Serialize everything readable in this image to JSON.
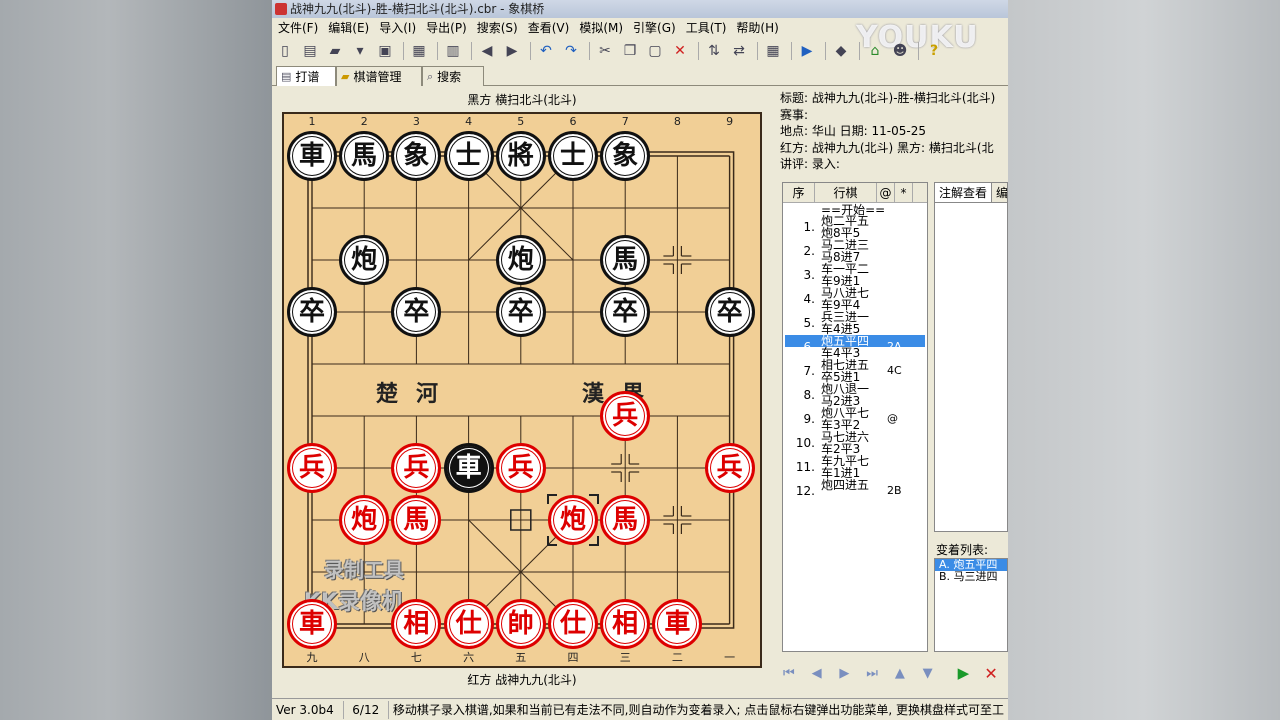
{
  "window": {
    "title": "战神九九(北斗)-胜-横扫北斗(北斗).cbr - 象棋桥"
  },
  "watermark": "YOUKU",
  "menus": [
    "文件(F)",
    "编辑(E)",
    "导入(I)",
    "导出(P)",
    "搜索(S)",
    "查看(V)",
    "模拟(M)",
    "引擎(G)",
    "工具(T)",
    "帮助(H)"
  ],
  "toolbar": [
    {
      "icon": "new-file-icon",
      "glyph": "▯"
    },
    {
      "icon": "list-icon",
      "glyph": "▤"
    },
    {
      "icon": "open-folder-icon",
      "glyph": "▰"
    },
    {
      "icon": "dropdown-icon",
      "glyph": "▾"
    },
    {
      "icon": "save-icon",
      "glyph": "▣"
    },
    {
      "sep": true
    },
    {
      "icon": "print-icon",
      "glyph": "▦"
    },
    {
      "sep": true
    },
    {
      "icon": "delete-icon",
      "glyph": "▥"
    },
    {
      "sep": true
    },
    {
      "icon": "back-icon",
      "glyph": "◀"
    },
    {
      "icon": "forward-icon",
      "glyph": "▶"
    },
    {
      "sep": true
    },
    {
      "icon": "undo-icon",
      "glyph": "↶"
    },
    {
      "icon": "redo-icon",
      "glyph": "↷"
    },
    {
      "sep": true
    },
    {
      "icon": "cut-icon",
      "glyph": "✂"
    },
    {
      "icon": "copy-icon",
      "glyph": "❐"
    },
    {
      "icon": "paste-icon",
      "glyph": "▢"
    },
    {
      "icon": "close-icon",
      "glyph": "✕"
    },
    {
      "sep": true
    },
    {
      "icon": "flip-vertical-icon",
      "glyph": "⇅"
    },
    {
      "icon": "flip-horizontal-icon",
      "glyph": "⇄"
    },
    {
      "sep": true
    },
    {
      "icon": "board-window-icon",
      "glyph": "▦"
    },
    {
      "sep": true
    },
    {
      "icon": "play-circle-icon",
      "glyph": "▶"
    },
    {
      "sep": true
    },
    {
      "icon": "tag-icon",
      "glyph": "◆"
    },
    {
      "sep": true
    },
    {
      "icon": "home-icon",
      "glyph": "⌂"
    },
    {
      "icon": "users-icon",
      "glyph": "☻"
    },
    {
      "sep": true
    },
    {
      "icon": "help-icon",
      "glyph": "?"
    }
  ],
  "tabs": [
    {
      "label": "打谱",
      "icon": "document-icon",
      "glyph": "▤",
      "active": true
    },
    {
      "label": "棋谱管理",
      "icon": "folder-icon",
      "glyph": "▰",
      "active": false
    },
    {
      "label": "搜索",
      "icon": "search-icon",
      "glyph": "⌕",
      "active": false
    }
  ],
  "board": {
    "top_player": "黑方  横扫北斗(北斗)",
    "bottom_player": "红方  战神九九(北斗)",
    "top_files": [
      "1",
      "2",
      "3",
      "4",
      "5",
      "6",
      "7",
      "8",
      "9"
    ],
    "bottom_files": [
      "九",
      "八",
      "七",
      "六",
      "五",
      "四",
      "三",
      "二",
      "一"
    ],
    "river_left": "楚河",
    "river_right": "漢界",
    "overlay_line1": "录制工具",
    "overlay_line2": "KK录像机",
    "pieces": [
      {
        "name": "black-chariot",
        "char": "車",
        "side": "black",
        "file": 0,
        "rank": 0
      },
      {
        "name": "black-horse",
        "char": "馬",
        "side": "black",
        "file": 1,
        "rank": 0
      },
      {
        "name": "black-elephant",
        "char": "象",
        "side": "black",
        "file": 2,
        "rank": 0
      },
      {
        "name": "black-advisor",
        "char": "士",
        "side": "black",
        "file": 3,
        "rank": 0
      },
      {
        "name": "black-general",
        "char": "將",
        "side": "black",
        "file": 4,
        "rank": 0
      },
      {
        "name": "black-advisor-2",
        "char": "士",
        "side": "black",
        "file": 5,
        "rank": 0
      },
      {
        "name": "black-elephant-2",
        "char": "象",
        "side": "black",
        "file": 6,
        "rank": 0
      },
      {
        "name": "black-cannon",
        "char": "炮",
        "side": "black",
        "file": 1,
        "rank": 2
      },
      {
        "name": "black-cannon-2",
        "char": "炮",
        "side": "black",
        "file": 4,
        "rank": 2
      },
      {
        "name": "black-horse-2",
        "char": "馬",
        "side": "black",
        "file": 6,
        "rank": 2
      },
      {
        "name": "black-soldier",
        "char": "卒",
        "side": "black",
        "file": 0,
        "rank": 3
      },
      {
        "name": "black-soldier-2",
        "char": "卒",
        "side": "black",
        "file": 2,
        "rank": 3
      },
      {
        "name": "black-soldier-3",
        "char": "卒",
        "side": "black",
        "file": 4,
        "rank": 3
      },
      {
        "name": "black-soldier-4",
        "char": "卒",
        "side": "black",
        "file": 6,
        "rank": 3
      },
      {
        "name": "black-soldier-5",
        "char": "卒",
        "side": "black",
        "file": 8,
        "rank": 3
      },
      {
        "name": "red-soldier",
        "char": "兵",
        "side": "red",
        "file": 6,
        "rank": 5
      },
      {
        "name": "red-soldier-2",
        "char": "兵",
        "side": "red",
        "file": 0,
        "rank": 6
      },
      {
        "name": "red-soldier-3",
        "char": "兵",
        "side": "red",
        "file": 2,
        "rank": 6
      },
      {
        "name": "black-chariot-2",
        "char": "車",
        "side": "rev-black",
        "file": 3,
        "rank": 6
      },
      {
        "name": "red-soldier-4",
        "char": "兵",
        "side": "red",
        "file": 4,
        "rank": 6
      },
      {
        "name": "red-soldier-5",
        "char": "兵",
        "side": "red",
        "file": 8,
        "rank": 6
      },
      {
        "name": "red-cannon",
        "char": "炮",
        "side": "red",
        "file": 1,
        "rank": 7
      },
      {
        "name": "red-horse",
        "char": "馬",
        "side": "red",
        "file": 2,
        "rank": 7
      },
      {
        "name": "red-cannon-2",
        "char": "炮",
        "side": "red",
        "file": 5,
        "rank": 7
      },
      {
        "name": "red-horse-2",
        "char": "馬",
        "side": "red",
        "file": 6,
        "rank": 7
      },
      {
        "name": "red-chariot",
        "char": "車",
        "side": "red",
        "file": 0,
        "rank": 9
      },
      {
        "name": "red-elephant",
        "char": "相",
        "side": "red",
        "file": 2,
        "rank": 9
      },
      {
        "name": "red-advisor",
        "char": "仕",
        "side": "red",
        "file": 3,
        "rank": 9
      },
      {
        "name": "red-general",
        "char": "帥",
        "side": "red",
        "file": 4,
        "rank": 9
      },
      {
        "name": "red-advisor-2",
        "char": "仕",
        "side": "red",
        "file": 5,
        "rank": 9
      },
      {
        "name": "red-elephant-2",
        "char": "相",
        "side": "red",
        "file": 6,
        "rank": 9
      },
      {
        "name": "red-chariot-2",
        "char": "車",
        "side": "red",
        "file": 7,
        "rank": 9
      }
    ],
    "last_move_from": {
      "file": 4,
      "rank": 7
    },
    "last_move_to": {
      "file": 5,
      "rank": 7
    },
    "point_marks": [
      {
        "file": 7,
        "rank": 2
      },
      {
        "file": 6,
        "rank": 6
      },
      {
        "file": 7,
        "rank": 7
      }
    ]
  },
  "game_info": {
    "title_line": "标题:  战神九九(北斗)-胜-横扫北斗(北斗)",
    "event_line": "赛事:",
    "place_line": "地点:  华山     日期:  11-05-25",
    "players_line": "红方:  战神九九(北斗)    黑方:  横扫北斗(北",
    "commentary_line": "讲评:       录入:"
  },
  "move_list": {
    "headers": [
      "序",
      "行棋",
      "@",
      "*"
    ],
    "start_label": "==开始==",
    "rows": [
      {
        "num": "1.",
        "red": "炮二平五",
        "black": "炮8平5",
        "comment": ""
      },
      {
        "num": "2.",
        "red": "马二进三",
        "black": "马8进7",
        "comment": ""
      },
      {
        "num": "3.",
        "red": "车一平二",
        "black": "车9进1",
        "comment": ""
      },
      {
        "num": "4.",
        "red": "马八进七",
        "black": "车9平4",
        "comment": ""
      },
      {
        "num": "5.",
        "red": "兵三进一",
        "black": "车4进5",
        "comment": ""
      },
      {
        "num": "6.",
        "red": "炮五平四",
        "black": "车4平3",
        "comment": "2A",
        "selected": true
      },
      {
        "num": "7.",
        "red": "相七进五",
        "black": "卒5进1",
        "comment": "4C"
      },
      {
        "num": "8.",
        "red": "炮八退一",
        "black": "马2进3",
        "comment": ""
      },
      {
        "num": "9.",
        "red": "炮八平七",
        "black": "车3平2",
        "comment": "@"
      },
      {
        "num": "10.",
        "red": "马七进六",
        "black": "车2平3",
        "comment": ""
      },
      {
        "num": "11.",
        "red": "车九平七",
        "black": "车1进1",
        "comment": ""
      },
      {
        "num": "12.",
        "red": "炮四进五",
        "black": "",
        "comment": "2B"
      }
    ]
  },
  "notes": {
    "tabs": [
      "注解查看",
      "编"
    ],
    "variations_label": "变着列表:",
    "variations": [
      {
        "label": "A.  炮五平四",
        "selected": true
      },
      {
        "label": "B.  马三进四",
        "selected": false
      }
    ]
  },
  "nav": [
    {
      "icon": "first-move-icon",
      "glyph": "⏮"
    },
    {
      "icon": "previous-move-icon",
      "glyph": "◀"
    },
    {
      "icon": "next-move-icon",
      "glyph": "▶"
    },
    {
      "icon": "last-move-icon",
      "glyph": "⏭"
    },
    {
      "icon": "up-variation-icon",
      "glyph": "▲"
    },
    {
      "icon": "down-variation-icon",
      "glyph": "▼"
    },
    {
      "icon": "play-icon",
      "glyph": "▶"
    },
    {
      "icon": "stop-icon",
      "glyph": "✕"
    }
  ],
  "status": {
    "version": "Ver 3.0b4",
    "move_count": "6/12",
    "message": "移动棋子录入棋谱,如果和当前已有走法不同,则自动作为变着录入; 点击鼠标右键弹出功能菜单, 更换棋盘样式可至工"
  },
  "colors": {
    "board": "#f1cf96",
    "red_piece": "#d00000",
    "black_piece": "#111111",
    "selection": "#3b8ce6",
    "window_bg": "#ece9d8"
  }
}
